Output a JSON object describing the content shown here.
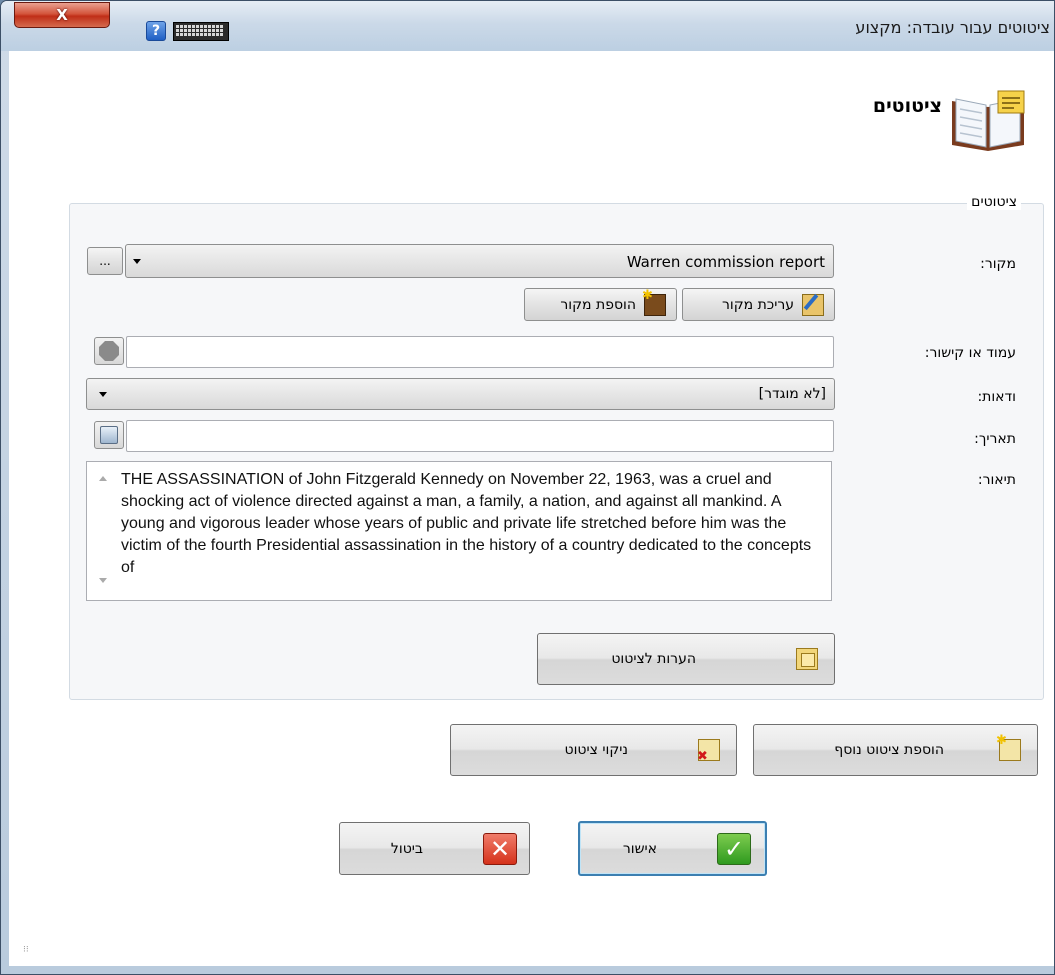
{
  "window": {
    "title": "ציטוטים עבור עובדה: מקצוע",
    "close_label": "X",
    "help_label": "?"
  },
  "header": {
    "title": "ציטוטים",
    "icon": "open-book-icon"
  },
  "group": {
    "label": "ציטוטים"
  },
  "form": {
    "source_label": "מקור:",
    "source_value": "Warren commission report",
    "source_browse_label": "...",
    "edit_source_label": "עריכת מקור",
    "add_source_label": "הוספת מקור",
    "page_label": "עמוד או קישור:",
    "page_value": "",
    "certainty_label": "ודאות:",
    "certainty_value": "[לא מוגדר]",
    "date_label": "תאריך:",
    "date_value": "",
    "description_label": "תיאור:",
    "description_text": "THE ASSASSINATION of John Fitzgerald Kennedy on November 22, 1963, was a cruel and shocking act of violence directed against a man, a family, a nation, and against all mankind. A young and vigorous leader whose years of public and private life stretched before him was the victim of the fourth Presidential assassination in the history of a country dedicated to the concepts of",
    "citation_notes_label": "הערות לציטוט"
  },
  "actions": {
    "clear_label": "ניקוי ציטוט",
    "add_another_label": "הוספת ציטוט נוסף",
    "ok_label": "אישור",
    "cancel_label": "ביטול"
  },
  "colors": {
    "accent": "#3c7fb1",
    "ok_green": "#2f9a1f",
    "cancel_red": "#d5321b"
  }
}
